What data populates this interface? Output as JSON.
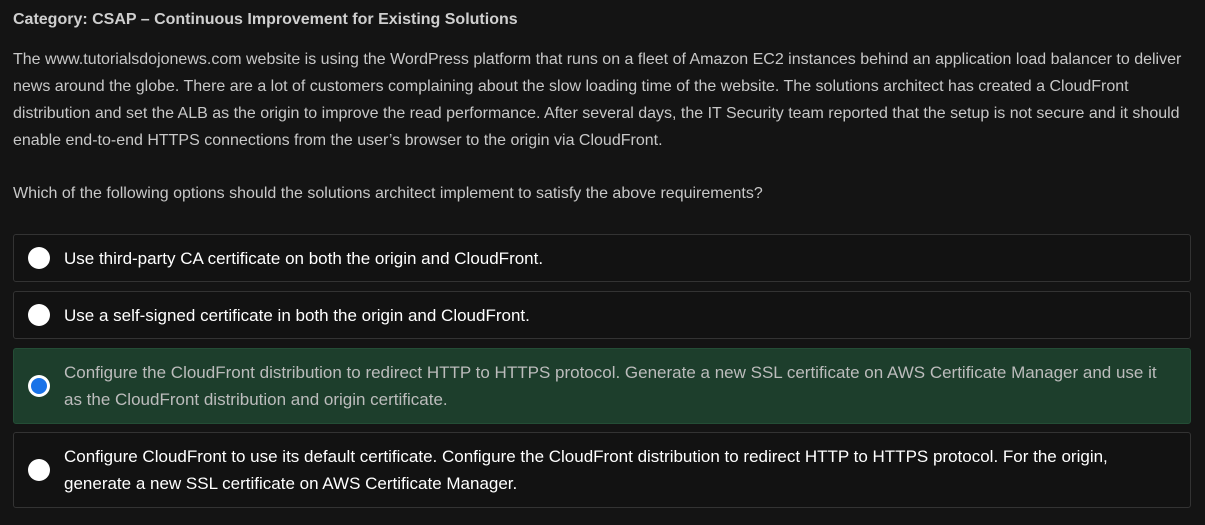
{
  "category": "Category: CSAP – Continuous Improvement for Existing Solutions",
  "question": "The www.tutorialsdojonews.com website is using the WordPress platform that runs on a fleet of Amazon EC2 instances behind an application load balancer to deliver news around the globe. There are a lot of customers complaining about the slow loading time of the website. The solutions architect has created a CloudFront distribution and set the ALB as the origin to improve the read performance. After several days, the IT Security team reported that the setup is not secure and it should enable end-to-end HTTPS connections from the user’s browser to the origin via CloudFront.",
  "prompt": "Which of the following options should the solutions architect implement to satisfy the above requirements?",
  "options": [
    {
      "text": "Use third-party CA certificate on both the origin and CloudFront.",
      "selected": false
    },
    {
      "text": "Use a self-signed certificate in both the origin and CloudFront.",
      "selected": false
    },
    {
      "text": "Configure the CloudFront distribution to redirect HTTP to HTTPS protocol. Generate a new SSL certificate on AWS Certificate Manager and use it as the CloudFront distribution and origin certificate.",
      "selected": true
    },
    {
      "text": "Configure CloudFront to use its default certificate. Configure the CloudFront distribution to redirect HTTP to HTTPS protocol. For the origin, generate a new SSL certificate on AWS Certificate Manager.",
      "selected": false
    }
  ],
  "colors": {
    "background": "#141414",
    "selected_option": "#1d3e2c",
    "radio_selected": "#1a73e8"
  }
}
